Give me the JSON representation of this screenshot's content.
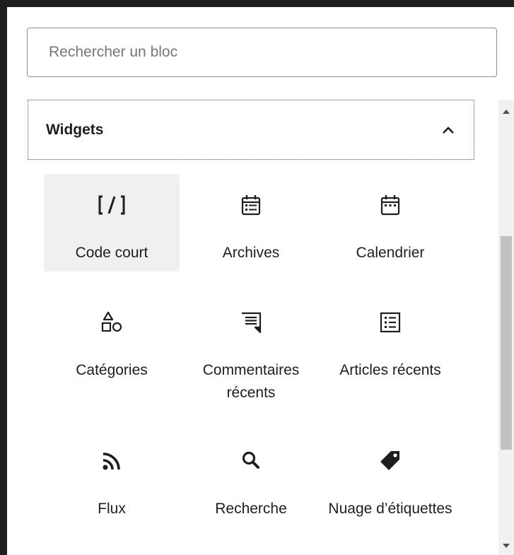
{
  "search": {
    "placeholder": "Rechercher un bloc",
    "value": ""
  },
  "section": {
    "title": "Widgets",
    "chevron_icon": "chevron-up-icon",
    "expanded": true
  },
  "blocks": [
    {
      "label": "Code court",
      "icon": "shortcode-icon",
      "selected": true
    },
    {
      "label": "Archives",
      "icon": "archive-calendar-icon"
    },
    {
      "label": "Calendrier",
      "icon": "calendar-icon"
    },
    {
      "label": "Catégories",
      "icon": "categories-shapes-icon"
    },
    {
      "label": "Commentaires récents",
      "icon": "comment-icon"
    },
    {
      "label": "Articles récents",
      "icon": "post-list-icon"
    },
    {
      "label": "Flux",
      "icon": "rss-icon"
    },
    {
      "label": "Recherche",
      "icon": "search-icon"
    },
    {
      "label": "Nuage d’étiquettes",
      "icon": "tag-icon"
    }
  ],
  "colors": {
    "text": "#1e1e1e",
    "selected_bg": "#f0f0f1",
    "border": "#8a8f94",
    "placeholder": "#757575"
  }
}
